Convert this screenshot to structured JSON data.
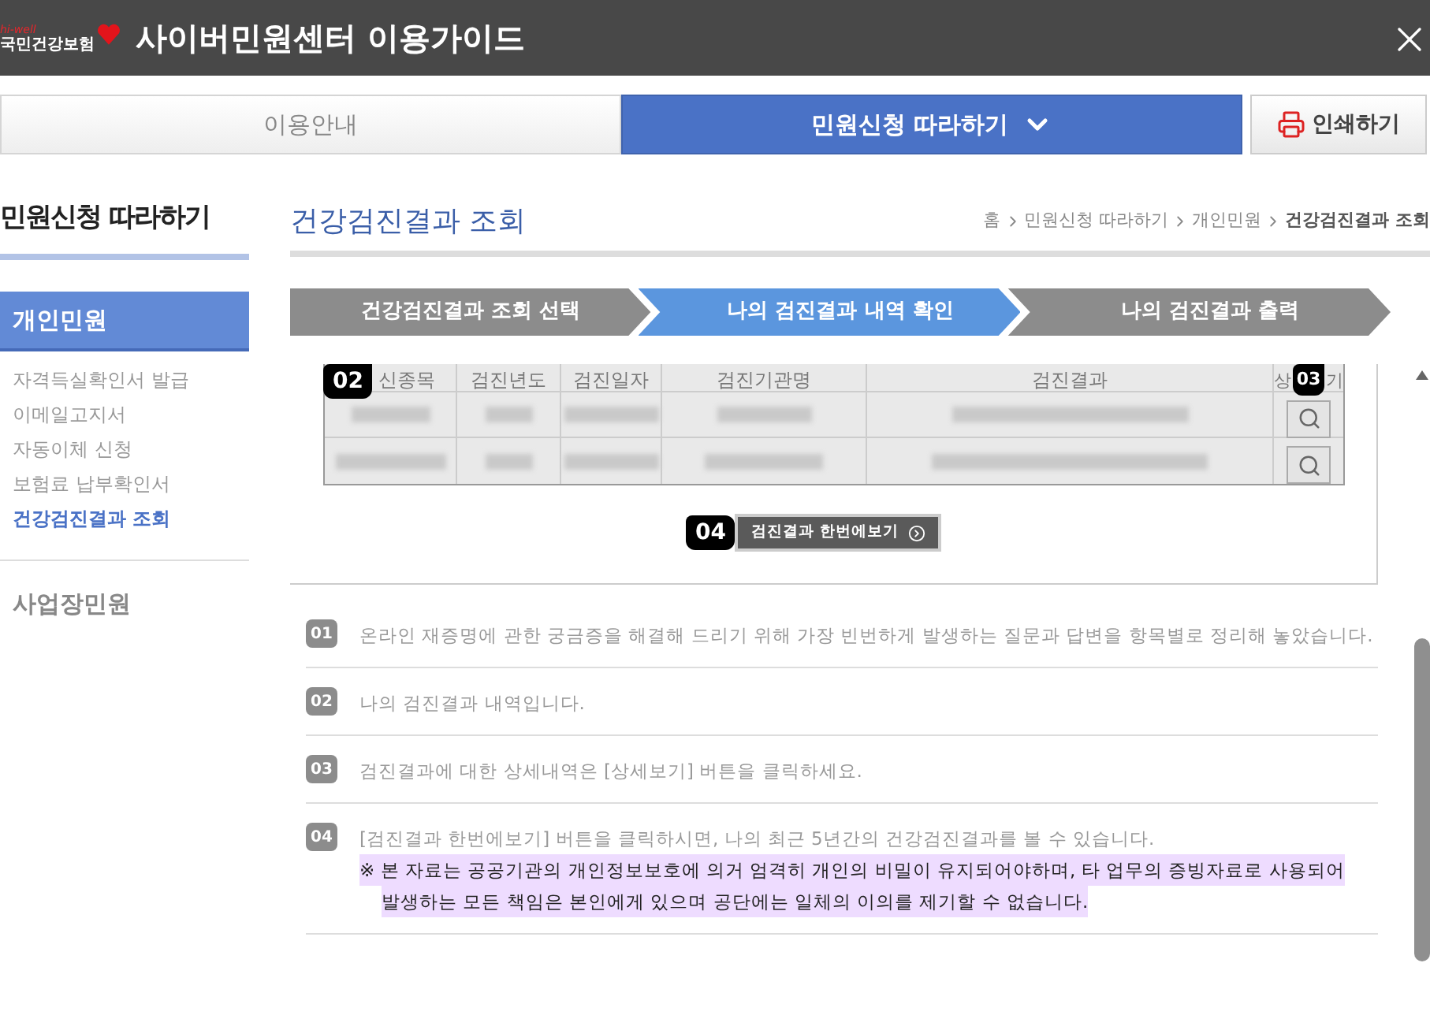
{
  "window": {
    "title": "사이버민원센터 이용가이드",
    "logo_tag": "hi-well",
    "logo_text": "국민건강보험"
  },
  "tabs": [
    {
      "label": "이용안내",
      "selected": false
    },
    {
      "label": "민원신청 따라하기",
      "selected": true
    }
  ],
  "print_button": "인쇄하기",
  "sidebar": {
    "title": "민원신청 따라하기",
    "groups": [
      {
        "label": "개인민원",
        "selected": true,
        "children": [
          {
            "label": "자격득실확인서 발급",
            "selected": false
          },
          {
            "label": "이메일고지서",
            "selected": false
          },
          {
            "label": "자동이체 신청",
            "selected": false
          },
          {
            "label": "보험료 납부확인서",
            "selected": false
          },
          {
            "label": "건강검진결과 조회",
            "selected": true
          }
        ]
      },
      {
        "label": "사업장민원",
        "selected": false
      }
    ]
  },
  "page_title": "건강검진결과 조회",
  "breadcrumb": [
    "홈",
    "민원신청 따라하기",
    "개인민원",
    "건강검진결과 조회"
  ],
  "steps": [
    {
      "label": "건강검진결과 조회 선택",
      "selected": false
    },
    {
      "label": "나의 검진결과 내역 확인",
      "selected": true
    },
    {
      "label": "나의 검진결과 출력",
      "selected": false
    }
  ],
  "table": {
    "columns": [
      "신종목",
      "검진년도",
      "검진일자",
      "검진기관명",
      "검진결과"
    ],
    "detail_column": [
      "상",
      "기"
    ],
    "rows": [
      {
        "blurred": true
      },
      {
        "blurred": true
      }
    ]
  },
  "markers": [
    "02",
    "03",
    "04"
  ],
  "view_all_button": "검진결과 한번에보기",
  "notes": [
    {
      "number": "01",
      "text": "온라인 재증명에 관한 궁금증을 해결해 드리기 위해 가장 빈번하게 발생하는 질문과 답변을 항목별로 정리해 놓았습니다."
    },
    {
      "number": "02",
      "text": "나의 검진결과 내역입니다."
    },
    {
      "number": "03",
      "text": "검진결과에 대한 상세내역은 [상세보기] 버튼을 클릭하세요."
    },
    {
      "number": "04",
      "text": "[검진결과 한번에보기] 버튼을 클릭하시면, 나의 최근 5년간의 건강검진결과를 볼 수 있습니다.",
      "warning": [
        "※ 본 자료는 공공기관의 개인정보보호에 의거 엄격히 개인의 비밀이 유지되어야하며, 타 업무의 증빙자료로 사용되어",
        "발생하는 모든 책임은 본인에게 있으며 공단에는 일체의 이의를 제기할 수 없습니다."
      ]
    }
  ]
}
